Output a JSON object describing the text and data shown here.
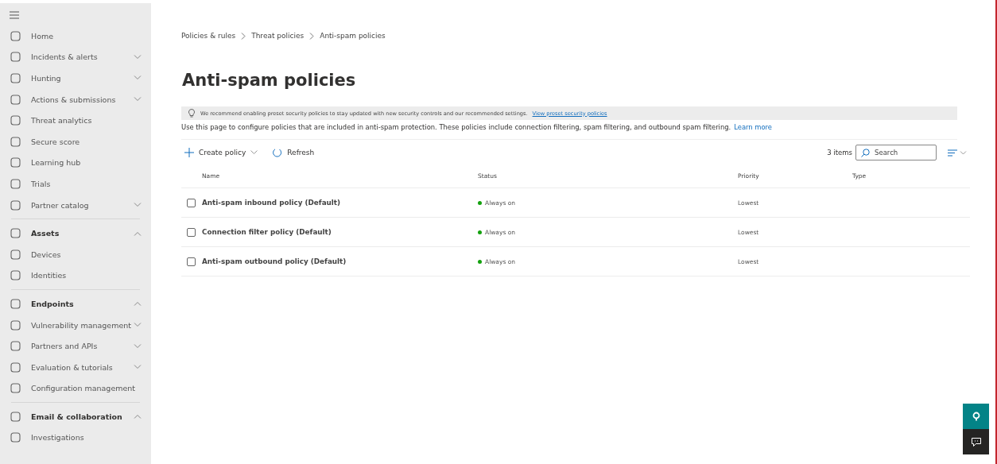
{
  "sidebar": {
    "items": [
      {
        "kind": "item",
        "label": "Home"
      },
      {
        "kind": "item",
        "label": "Incidents & alerts",
        "expanded": false
      },
      {
        "kind": "item",
        "label": "Hunting",
        "expanded": false
      },
      {
        "kind": "item",
        "label": "Actions & submissions",
        "expanded": false
      },
      {
        "kind": "item",
        "label": "Threat analytics"
      },
      {
        "kind": "item",
        "label": "Secure score"
      },
      {
        "kind": "item",
        "label": "Learning hub"
      },
      {
        "kind": "item",
        "label": "Trials"
      },
      {
        "kind": "item",
        "label": "Partner catalog",
        "expanded": false
      },
      {
        "kind": "header",
        "label": "Assets",
        "expanded": true
      },
      {
        "kind": "item",
        "label": "Devices"
      },
      {
        "kind": "item",
        "label": "Identities"
      },
      {
        "kind": "header",
        "label": "Endpoints",
        "expanded": true
      },
      {
        "kind": "item",
        "label": "Vulnerability management",
        "expanded": false
      },
      {
        "kind": "item",
        "label": "Partners and APIs",
        "expanded": false
      },
      {
        "kind": "item",
        "label": "Evaluation & tutorials",
        "expanded": false
      },
      {
        "kind": "item",
        "label": "Configuration management"
      },
      {
        "kind": "header",
        "label": "Email & collaboration",
        "expanded": true
      },
      {
        "kind": "item",
        "label": "Investigations"
      }
    ]
  },
  "breadcrumb": [
    "Policies & rules",
    "Threat policies",
    "Anti-spam policies"
  ],
  "title": "Anti-spam policies",
  "banner": {
    "text": "We recommend enabling preset security policies to stay updated with new security controls and our recommended settings.",
    "link": "View preset security policies"
  },
  "description": {
    "text": "Use this page to configure policies that are included in anti-spam protection. These policies include connection filtering, spam filtering, and outbound spam filtering.",
    "link": "Learn more"
  },
  "toolbar": {
    "create": "Create policy",
    "refresh": "Refresh",
    "count": "3 items",
    "search": {
      "placeholder": "Search"
    }
  },
  "table": {
    "columns": [
      "Name",
      "Status",
      "Priority",
      "Type"
    ],
    "rows": [
      {
        "name": "Anti-spam inbound policy (Default)",
        "status": "Always on",
        "color": "#13a10e",
        "priority": "Lowest",
        "checked": false
      },
      {
        "name": "Connection filter policy (Default)",
        "status": "Always on",
        "color": "#13a10e",
        "priority": "Lowest",
        "checked": false
      },
      {
        "name": "Anti-spam outbound policy (Default)",
        "status": "Always on",
        "color": "#13a10e",
        "priority": "Lowest",
        "checked": false
      }
    ]
  }
}
